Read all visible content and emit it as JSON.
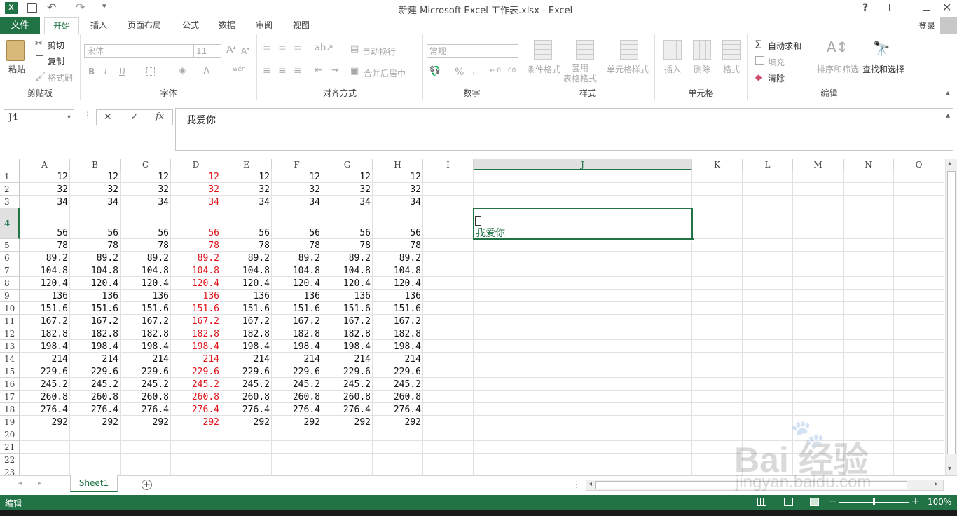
{
  "title": "新建 Microsoft Excel 工作表.xlsx - Excel",
  "titlebar_controls": {
    "help": "?"
  },
  "login": "登录",
  "tabs": [
    "文件",
    "开始",
    "插入",
    "页面布局",
    "公式",
    "数据",
    "审阅",
    "视图"
  ],
  "clipboard": {
    "paste": "粘贴",
    "cut": "剪切",
    "copy": "复制",
    "format_painter": "格式刷",
    "label": "剪贴板"
  },
  "font": {
    "name": "宋体",
    "size": "11",
    "bold": "B",
    "italic": "I",
    "underline": "U",
    "label": "字体"
  },
  "alignment": {
    "wrap": "自动换行",
    "merge": "合并后居中",
    "label": "对齐方式"
  },
  "number": {
    "format": "常规",
    "percent": "%",
    "comma": ",",
    "label": "数字"
  },
  "styles": {
    "conditional": "条件格式",
    "table": "套用\n表格格式",
    "cell": "单元格样式",
    "label": "样式"
  },
  "cells": {
    "insert": "插入",
    "delete": "删除",
    "format": "格式",
    "label": "单元格"
  },
  "editing": {
    "autosum": "自动求和",
    "fill": "填充",
    "clear": "清除",
    "sort": "排序和筛选",
    "find": "查找和选择",
    "label": "编辑"
  },
  "formula_bar": {
    "name_box": "J4",
    "fx": "fx",
    "content": "我爱你"
  },
  "columns": [
    "A",
    "B",
    "C",
    "D",
    "E",
    "F",
    "G",
    "H",
    "I",
    "J",
    "K",
    "L",
    "M",
    "N",
    "O"
  ],
  "selected_column": "J",
  "selected_row": 4,
  "rows": [
    [
      "12",
      "12",
      "12",
      "12",
      "12",
      "12",
      "12",
      "12"
    ],
    [
      "32",
      "32",
      "32",
      "32",
      "32",
      "32",
      "32",
      "32"
    ],
    [
      "34",
      "34",
      "34",
      "34",
      "34",
      "34",
      "34",
      "34"
    ],
    [
      "56",
      "56",
      "56",
      "56",
      "56",
      "56",
      "56",
      "56"
    ],
    [
      "78",
      "78",
      "78",
      "78",
      "78",
      "78",
      "78",
      "78"
    ],
    [
      "89.2",
      "89.2",
      "89.2",
      "89.2",
      "89.2",
      "89.2",
      "89.2",
      "89.2"
    ],
    [
      "104.8",
      "104.8",
      "104.8",
      "104.8",
      "104.8",
      "104.8",
      "104.8",
      "104.8"
    ],
    [
      "120.4",
      "120.4",
      "120.4",
      "120.4",
      "120.4",
      "120.4",
      "120.4",
      "120.4"
    ],
    [
      "136",
      "136",
      "136",
      "136",
      "136",
      "136",
      "136",
      "136"
    ],
    [
      "151.6",
      "151.6",
      "151.6",
      "151.6",
      "151.6",
      "151.6",
      "151.6",
      "151.6"
    ],
    [
      "167.2",
      "167.2",
      "167.2",
      "167.2",
      "167.2",
      "167.2",
      "167.2",
      "167.2"
    ],
    [
      "182.8",
      "182.8",
      "182.8",
      "182.8",
      "182.8",
      "182.8",
      "182.8",
      "182.8"
    ],
    [
      "198.4",
      "198.4",
      "198.4",
      "198.4",
      "198.4",
      "198.4",
      "198.4",
      "198.4"
    ],
    [
      "214",
      "214",
      "214",
      "214",
      "214",
      "214",
      "214",
      "214"
    ],
    [
      "229.6",
      "229.6",
      "229.6",
      "229.6",
      "229.6",
      "229.6",
      "229.6",
      "229.6"
    ],
    [
      "245.2",
      "245.2",
      "245.2",
      "245.2",
      "245.2",
      "245.2",
      "245.2",
      "245.2"
    ],
    [
      "260.8",
      "260.8",
      "260.8",
      "260.8",
      "260.8",
      "260.8",
      "260.8",
      "260.8"
    ],
    [
      "276.4",
      "276.4",
      "276.4",
      "276.4",
      "276.4",
      "276.4",
      "276.4",
      "276.4"
    ],
    [
      "292",
      "292",
      "292",
      "292",
      "292",
      "292",
      "292",
      "292"
    ],
    [
      "",
      "",
      "",
      "",
      "",
      "",
      "",
      ""
    ],
    [
      "",
      "",
      "",
      "",
      "",
      "",
      "",
      ""
    ],
    [
      "",
      "",
      "",
      "",
      "",
      "",
      "",
      ""
    ],
    [
      "",
      "",
      "",
      "",
      "",
      "",
      "",
      ""
    ]
  ],
  "red_column": "D",
  "active_cell_text": "我爱你",
  "sheet_tab": "Sheet1",
  "status": {
    "mode": "编辑",
    "zoom": "100%"
  },
  "watermark": {
    "brand": "Bai 经验",
    "url": "jingyan.baidu.com"
  },
  "colors": {
    "accent": "#217346",
    "red": "#e0141a"
  }
}
